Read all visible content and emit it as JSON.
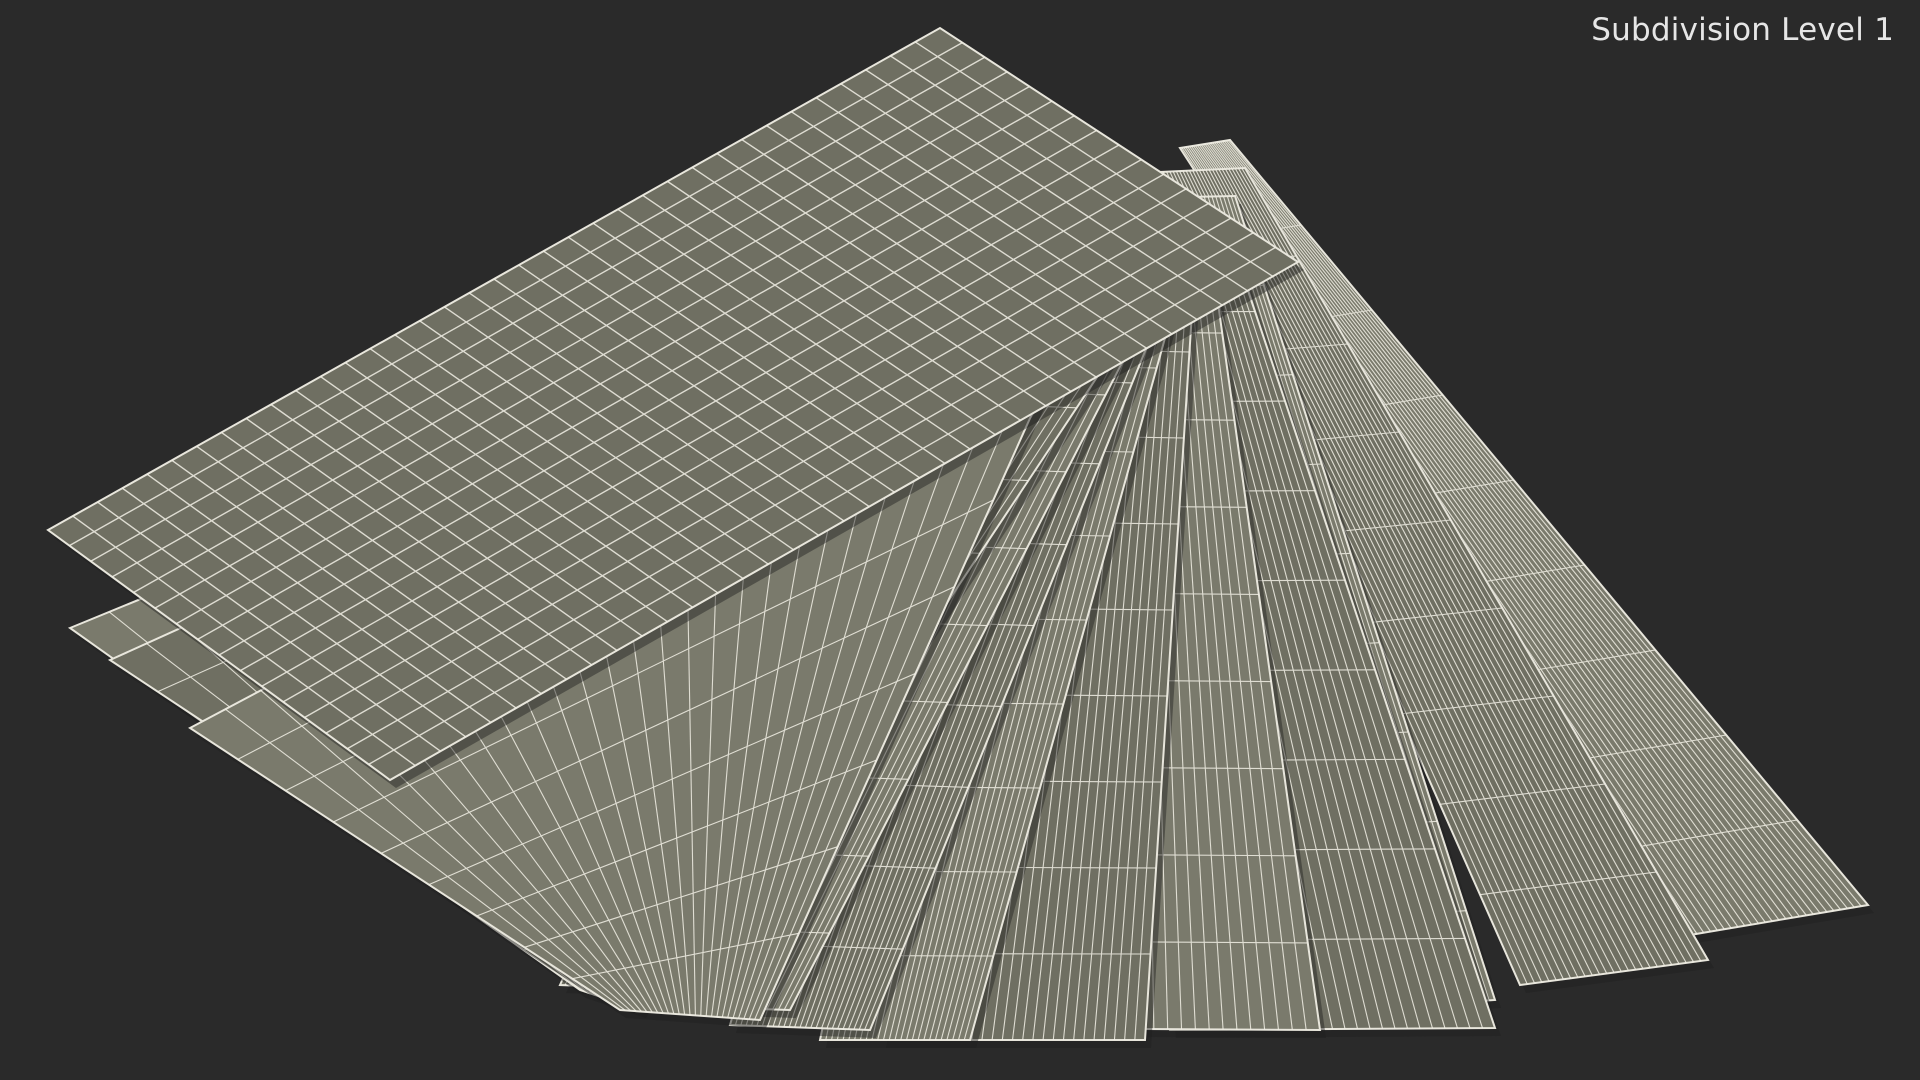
{
  "viewport": {
    "overlay_label": "Subdivision Level 1"
  },
  "scene": {
    "object": "stack of fanned-out sheets",
    "sheet_count": 14,
    "colors": {
      "background": "#2a2a2a",
      "sheet_fill": "#7a7a6c",
      "sheet_fill_shaded": "#6f6f62",
      "wire": "#f2f0e6",
      "edge": "#e8e6dc",
      "shadow": "#1e1e1e"
    }
  }
}
